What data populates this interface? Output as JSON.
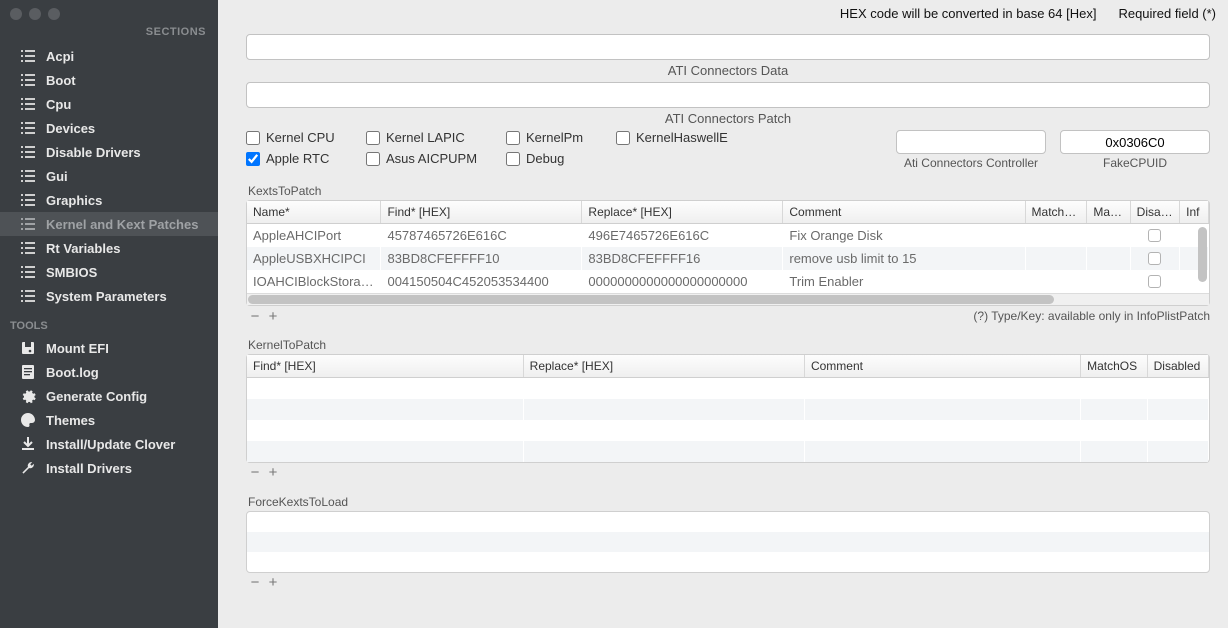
{
  "header": {
    "sections_label": "SECTIONS",
    "tools_label": "TOOLS",
    "hex_notice": "HEX code will be converted in base 64 [Hex]",
    "required_notice": "Required field (*)"
  },
  "sidebar": {
    "sections": [
      {
        "label": "Acpi",
        "icon": "list"
      },
      {
        "label": "Boot",
        "icon": "list"
      },
      {
        "label": "Cpu",
        "icon": "list"
      },
      {
        "label": "Devices",
        "icon": "list"
      },
      {
        "label": "Disable Drivers",
        "icon": "list"
      },
      {
        "label": "Gui",
        "icon": "list"
      },
      {
        "label": "Graphics",
        "icon": "list"
      },
      {
        "label": "Kernel and Kext Patches",
        "icon": "list",
        "selected": true
      },
      {
        "label": "Rt Variables",
        "icon": "list"
      },
      {
        "label": "SMBIOS",
        "icon": "list"
      },
      {
        "label": "System Parameters",
        "icon": "list"
      }
    ],
    "tools": [
      {
        "label": "Mount EFI",
        "icon": "disk"
      },
      {
        "label": "Boot.log",
        "icon": "log"
      },
      {
        "label": "Generate Config",
        "icon": "gear"
      },
      {
        "label": "Themes",
        "icon": "palette"
      },
      {
        "label": "Install/Update Clover",
        "icon": "download"
      },
      {
        "label": "Install Drivers",
        "icon": "wrench"
      }
    ]
  },
  "ati": {
    "data_label": "ATI Connectors Data",
    "patch_label": "ATI Connectors Patch"
  },
  "checks": {
    "kernel_cpu": {
      "label": "Kernel CPU",
      "checked": false
    },
    "kernel_lapic": {
      "label": "Kernel LAPIC",
      "checked": false
    },
    "kernelpm": {
      "label": "KernelPm",
      "checked": false
    },
    "kernelhaswelle": {
      "label": "KernelHaswellE",
      "checked": false
    },
    "apple_rtc": {
      "label": "Apple RTC",
      "checked": true
    },
    "asus_aicpupm": {
      "label": "Asus AICPUPM",
      "checked": false
    },
    "debug": {
      "label": "Debug",
      "checked": false
    }
  },
  "right_fields": {
    "ati_ctrl": {
      "value": "",
      "label": "Ati Connectors Controller"
    },
    "fakecpuid": {
      "value": "0x0306C0",
      "label": "FakeCPUID"
    }
  },
  "kexts": {
    "title": "KextsToPatch",
    "headers": {
      "name": "Name*",
      "find": "Find* [HEX]",
      "replace": "Replace* [HEX]",
      "comment": "Comment",
      "matchos": "MatchOS",
      "matchbuild": "Matc...",
      "disabled": "Disabl...",
      "info": "Inf"
    },
    "rows": [
      {
        "name": "AppleAHCIPort",
        "find": "45787465726E616C",
        "replace": "496E7465726E616C",
        "comment": "Fix Orange Disk",
        "disabled": false
      },
      {
        "name": "AppleUSBXHCIPCI",
        "find": "83BD8CFEFFFF10",
        "replace": "83BD8CFEFFFF16",
        "comment": "remove usb limit to 15",
        "disabled": false
      },
      {
        "name": "IOAHCIBlockStorage",
        "find": "004150504C452053534400",
        "replace": "0000000000000000000000",
        "comment": "Trim Enabler",
        "disabled": false
      }
    ],
    "hint": "(?) Type/Key: available only in InfoPlistPatch"
  },
  "kernel": {
    "title": "KernelToPatch",
    "headers": {
      "find": "Find* [HEX]",
      "replace": "Replace* [HEX]",
      "comment": "Comment",
      "matchos": "MatchOS",
      "disabled": "Disabled"
    }
  },
  "force": {
    "title": "ForceKextsToLoad"
  },
  "buttons": {
    "minus": "−",
    "plus": "+"
  }
}
